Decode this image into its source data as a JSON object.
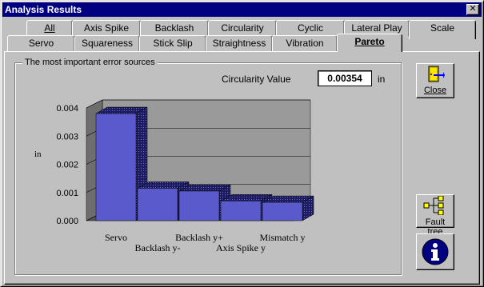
{
  "window": {
    "title": "Analysis Results",
    "close_glyph": "✕"
  },
  "tabs_row1": [
    {
      "label": "All"
    },
    {
      "label": "Axis Spike"
    },
    {
      "label": "Backlash"
    },
    {
      "label": "Circularity"
    },
    {
      "label": "Cyclic"
    },
    {
      "label": "Lateral Play"
    },
    {
      "label": "Scale"
    }
  ],
  "tabs_row2": [
    {
      "label": "Servo"
    },
    {
      "label": "Squareness"
    },
    {
      "label": "Stick Slip"
    },
    {
      "label": "Straightness"
    },
    {
      "label": "Vibration"
    },
    {
      "label": "Pareto"
    }
  ],
  "active_tab": "Pareto",
  "group": {
    "label": "The most important error sources",
    "circularity_label": "Circularity Value",
    "circularity_value": "0.00354",
    "circularity_unit": "in"
  },
  "buttons": {
    "close_label": "Close",
    "fault_tree_label": "Fault tree",
    "info_icon": "info-icon"
  },
  "colors": {
    "bar_face": "#5a5acd",
    "bar_dark": "#2c2c7e",
    "bar_top": "#3a3a9a",
    "plot_back": "#9a9a9a",
    "plot_wall": "#6e6e6e",
    "plot_floor": "#555555"
  },
  "chart_data": {
    "type": "bar",
    "ylabel": "in",
    "ylim": [
      0,
      0.004
    ],
    "yticks": [
      "0.000",
      "0.001",
      "0.002",
      "0.003",
      "0.004"
    ],
    "grid": true,
    "categories": [
      "Servo",
      "Backlash y-",
      "Backlash y+",
      "Axis Spike y",
      "Mismatch y"
    ],
    "values": [
      0.0038,
      0.00115,
      0.00105,
      0.0007,
      0.00065
    ]
  }
}
